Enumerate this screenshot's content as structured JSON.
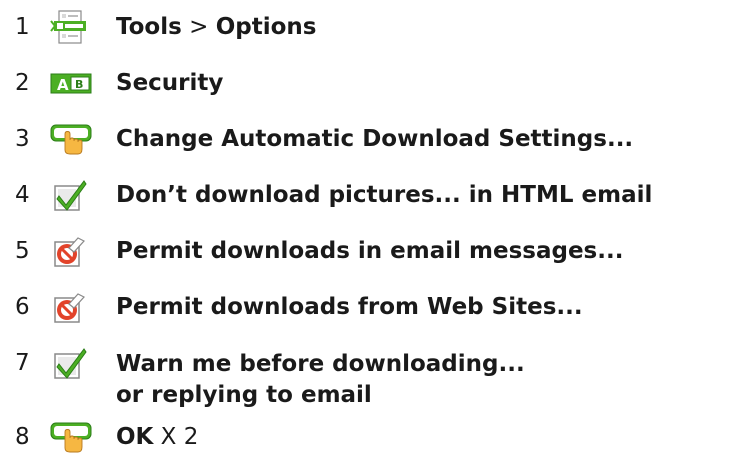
{
  "steps": [
    {
      "num": "1",
      "icon": "options-list-icon",
      "bold1": "Tools",
      "sep": " > ",
      "bold2": "Options"
    },
    {
      "num": "2",
      "icon": "ab-tab-icon",
      "bold1": "Security"
    },
    {
      "num": "3",
      "icon": "click-button-icon",
      "bold1": "Change Automatic Download Settings..."
    },
    {
      "num": "4",
      "icon": "checkbox-checked-icon",
      "bold1": "Don’t download pictures... in HTML email"
    },
    {
      "num": "5",
      "icon": "checkbox-unchecked-icon",
      "bold1": "Permit downloads in email messages..."
    },
    {
      "num": "6",
      "icon": "checkbox-unchecked-icon",
      "bold1": "Permit downloads from Web Sites..."
    },
    {
      "num": "7",
      "icon": "checkbox-checked-icon",
      "bold1": "Warn me before downloading...",
      "bold1b": "or replying to email"
    },
    {
      "num": "8",
      "icon": "click-button-icon",
      "bold1": "OK",
      "suffix": " X 2"
    }
  ],
  "colors": {
    "green": "#4caf24",
    "dark_green": "#2b7d18",
    "hand": "#f6b742",
    "red": "#e2432a",
    "text": "#1a1a1a"
  }
}
